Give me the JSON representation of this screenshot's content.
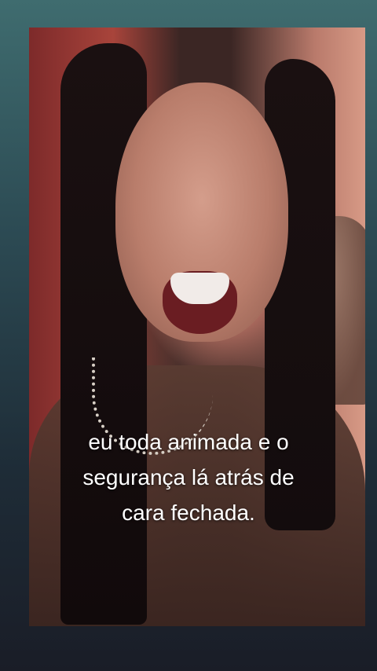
{
  "caption": {
    "line1": "eu toda animada e o",
    "line2": "segurança lá atrás de",
    "line3": "cara fechada."
  },
  "colors": {
    "background_top": "#3f6c6f",
    "background_bottom": "#1a1d27",
    "caption_text": "#ffffff"
  }
}
